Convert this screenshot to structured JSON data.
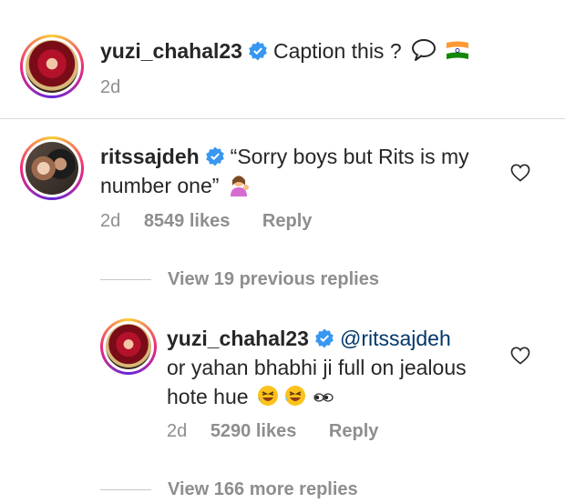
{
  "post": {
    "username": "yuzi_chahal23",
    "caption": "Caption this ?",
    "time": "2d"
  },
  "comment": {
    "username": "ritssajdeh",
    "text_line1": "“Sorry boys but Rits is my",
    "text_line2": "number one”",
    "time": "2d",
    "likes": "8549 likes",
    "reply": "Reply"
  },
  "view_previous": "View 19 previous replies",
  "reply_comment": {
    "username": "yuzi_chahal23",
    "mention": "@ritssajdeh",
    "text_line1": "or yahan bhabhi ji full on jealous",
    "text_line2": "hote hue",
    "time": "2d",
    "likes": "5290 likes",
    "reply": "Reply"
  },
  "view_more": "View 166 more replies",
  "colors": {
    "text": "#262626",
    "secondary": "#8e8e8e",
    "link": "#00376b",
    "verified": "#3897f0"
  }
}
